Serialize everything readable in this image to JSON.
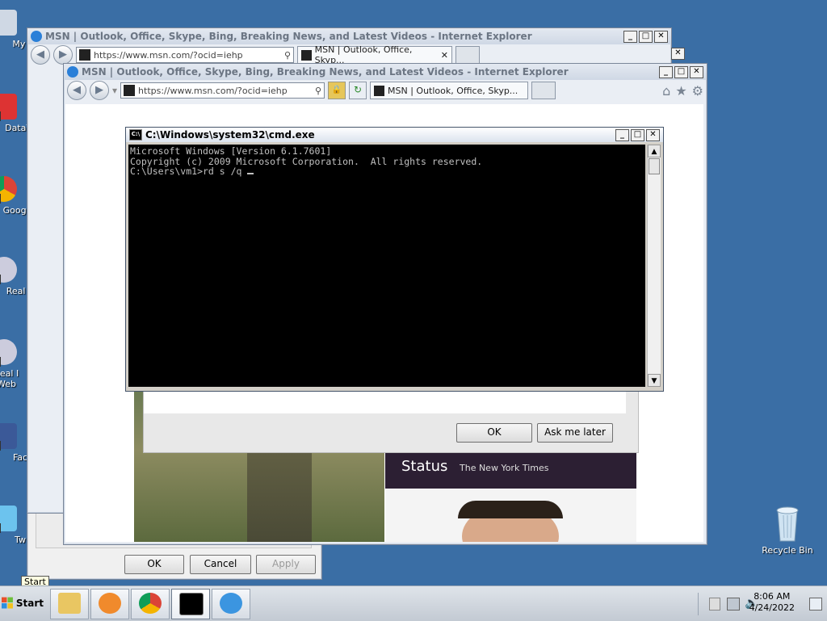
{
  "desktop": {
    "icons_left": [
      {
        "label": "My C"
      },
      {
        "label": "DataV"
      },
      {
        "label": "Google"
      },
      {
        "label": "Real I"
      },
      {
        "label": "Real I Web"
      },
      {
        "label": "Fac"
      },
      {
        "label": "Tw"
      }
    ],
    "recycle_bin": {
      "label": "Recycle Bin"
    }
  },
  "ie_back": {
    "title": "MSN | Outlook, Office, Skype, Bing, Breaking News, and Latest Videos - Internet Explorer",
    "address": "https://www.msn.com/?ocid=iehp",
    "tab_label": "MSN | Outlook, Office, Skyp..."
  },
  "ie_front": {
    "title": "MSN | Outlook, Office, Skype, Bing, Breaking News, and Latest Videos - Internet Explorer",
    "address": "https://www.msn.com/?ocid=iehp",
    "tab_label": "MSN | Outlook, Office, Skyp...",
    "news": {
      "headline": "Status",
      "source": "The New York Times"
    },
    "dialog": {
      "ok_label": "OK",
      "ask_label": "Ask me later"
    }
  },
  "back_dialog": {
    "ok_label": "OK",
    "cancel_label": "Cancel",
    "apply_label": "Apply"
  },
  "cmd": {
    "title": "C:\\Windows\\system32\\cmd.exe",
    "icon_text": "C:\\",
    "lines": [
      "Microsoft Windows [Version 6.1.7601]",
      "Copyright (c) 2009 Microsoft Corporation.  All rights reserved.",
      "",
      "C:\\Users\\vm1>rd s /q "
    ]
  },
  "taskbar": {
    "start_label": "Start",
    "tooltip": "Start",
    "time": "8:06 AM",
    "date": "4/24/2022"
  },
  "colors": {
    "desktop": "#3a6ea5",
    "console_bg": "#000000",
    "console_fg": "#c0c0c0"
  },
  "window_buttons": {
    "min": "_",
    "max": "□",
    "close": "✕"
  },
  "icons": {
    "back": "◀",
    "forward": "▶",
    "home": "⌂",
    "star": "★",
    "gear": "⚙",
    "search": "⚲",
    "dropdown": "▾",
    "lock": "🔒",
    "refresh": "↻",
    "up": "▲",
    "down": "▼"
  }
}
